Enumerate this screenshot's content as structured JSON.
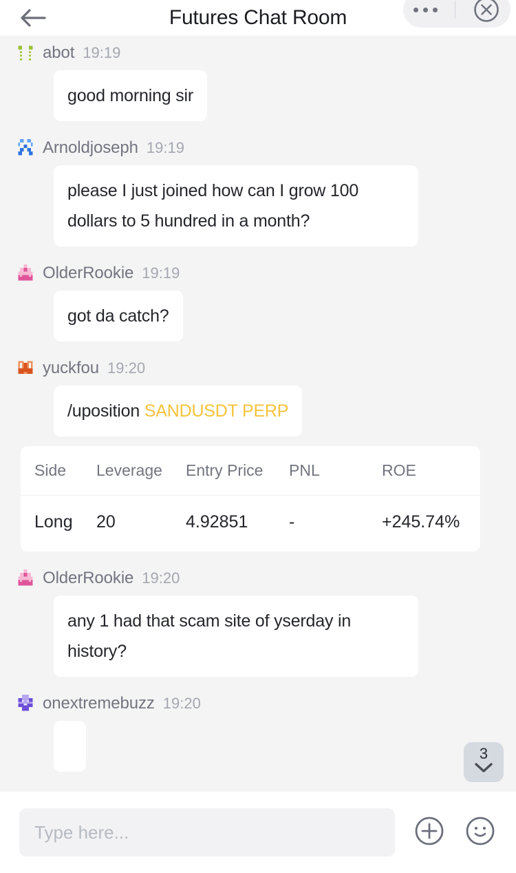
{
  "header": {
    "title": "Futures Chat Room",
    "back_icon": "arrow-left-icon",
    "more_icon": "more-horizontal-icon",
    "close_icon": "close-circle-icon"
  },
  "messages": [
    {
      "username": "abot",
      "time": "19:19",
      "avatar_color": "#9ac236",
      "avatar_id": "identicon-abot",
      "text": "good morning sir"
    },
    {
      "username": "Arnoldjoseph",
      "time": "19:19",
      "avatar_color": "#3b82f6",
      "avatar_id": "identicon-arnoldjoseph",
      "text": "please I just joined how can I grow 100 dollars to 5 hundred in a month?"
    },
    {
      "username": "OlderRookie",
      "time": "19:19",
      "avatar_color": "#e0559a",
      "avatar_id": "identicon-olderrookie",
      "text": "got da catch?"
    },
    {
      "username": "yuckfou",
      "time": "19:20",
      "avatar_color": "#e2622a",
      "avatar_id": "identicon-yuckfou",
      "command": "/uposition",
      "command_arg": "SANDUSDT PERP"
    },
    {
      "username": "OlderRookie",
      "time": "19:20",
      "avatar_color": "#e0559a",
      "avatar_id": "identicon-olderrookie",
      "text": "any 1 had that scam site of yserday in history?"
    },
    {
      "username": "onextremebuzz",
      "time": "19:20",
      "avatar_color": "#7c5ce0",
      "avatar_id": "identicon-onextremebuzz",
      "text": ""
    }
  ],
  "position_table": {
    "headers": [
      "Side",
      "Leverage",
      "Entry Price",
      "PNL",
      "ROE"
    ],
    "rows": [
      {
        "side": "Long",
        "leverage": "20",
        "entry_price": "4.92851",
        "pnl": "-",
        "roe": "+245.74%"
      }
    ],
    "roe_color": "#2e9e6b"
  },
  "scroll_badge": {
    "count": "3",
    "icon": "chevron-down-icon"
  },
  "composer": {
    "placeholder": "Type here...",
    "value": "",
    "attach_icon": "plus-circle-icon",
    "emoji_icon": "smiley-icon"
  },
  "colors": {
    "accent_yellow": "#f5c33b",
    "positive_green": "#2e9e6b",
    "background": "#f4f4f5",
    "bubble": "#ffffff"
  }
}
